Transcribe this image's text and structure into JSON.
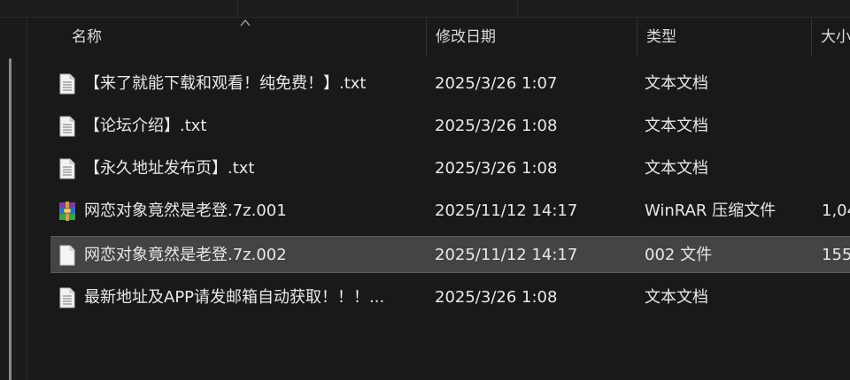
{
  "columns": {
    "name": "名称",
    "date": "修改日期",
    "type": "类型",
    "size": "大小"
  },
  "files": [
    {
      "name": "【来了就能下载和观看！纯免费！】.txt",
      "date": "2025/3/26 1:07",
      "type": "文本文档",
      "size": "",
      "icon": "text-file-icon"
    },
    {
      "name": "【论坛介绍】.txt",
      "date": "2025/3/26 1:08",
      "type": "文本文档",
      "size": "",
      "icon": "text-file-icon"
    },
    {
      "name": "【永久地址发布页】.txt",
      "date": "2025/3/26 1:08",
      "type": "文本文档",
      "size": "",
      "icon": "text-file-icon"
    },
    {
      "name": "网恋对象竟然是老登.7z.001",
      "date": "2025/11/12 14:17",
      "type": "WinRAR 压缩文件",
      "size": "1,04",
      "icon": "winrar-archive-icon"
    },
    {
      "name": "网恋对象竟然是老登.7z.002",
      "date": "2025/11/12 14:17",
      "type": "002 文件",
      "size": "155",
      "icon": "blank-file-icon",
      "selected": true
    },
    {
      "name": "最新地址及APP请发邮箱自动获取！！！...",
      "date": "2025/3/26 1:08",
      "type": "文本文档",
      "size": "",
      "icon": "text-file-icon"
    }
  ],
  "colors": {
    "background": "#191919",
    "selected_row": "#444444",
    "text": "#e8e8e8"
  }
}
